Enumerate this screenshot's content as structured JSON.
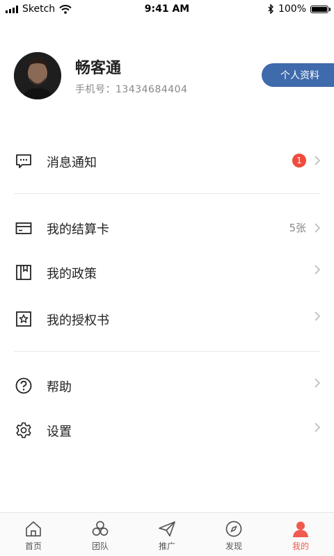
{
  "status_bar": {
    "carrier": "Sketch",
    "time": "9:41 AM",
    "battery": "100%",
    "battery_level": 1.0
  },
  "profile": {
    "name": "畅客通",
    "phone": "手机号：13434684404",
    "button": "个人资料"
  },
  "menu": {
    "notifications": {
      "label": "消息通知",
      "badge": "1"
    },
    "card": {
      "label": "我的结算卡",
      "count": "5张"
    },
    "policy": {
      "label": "我的政策"
    },
    "authorization": {
      "label": "我的授权书"
    },
    "help": {
      "label": "帮助"
    },
    "settings": {
      "label": "设置"
    }
  },
  "tabs": [
    {
      "label": "首页",
      "icon": "home-icon"
    },
    {
      "label": "团队",
      "icon": "team-icon"
    },
    {
      "label": "推广",
      "icon": "paper-plane-icon"
    },
    {
      "label": "发现",
      "icon": "compass-icon"
    },
    {
      "label": "我的",
      "icon": "user-icon",
      "active": true
    }
  ],
  "colors": {
    "accent": "#3f6aab",
    "active_tab": "#f05a4f",
    "badge": "#f14b3e"
  }
}
